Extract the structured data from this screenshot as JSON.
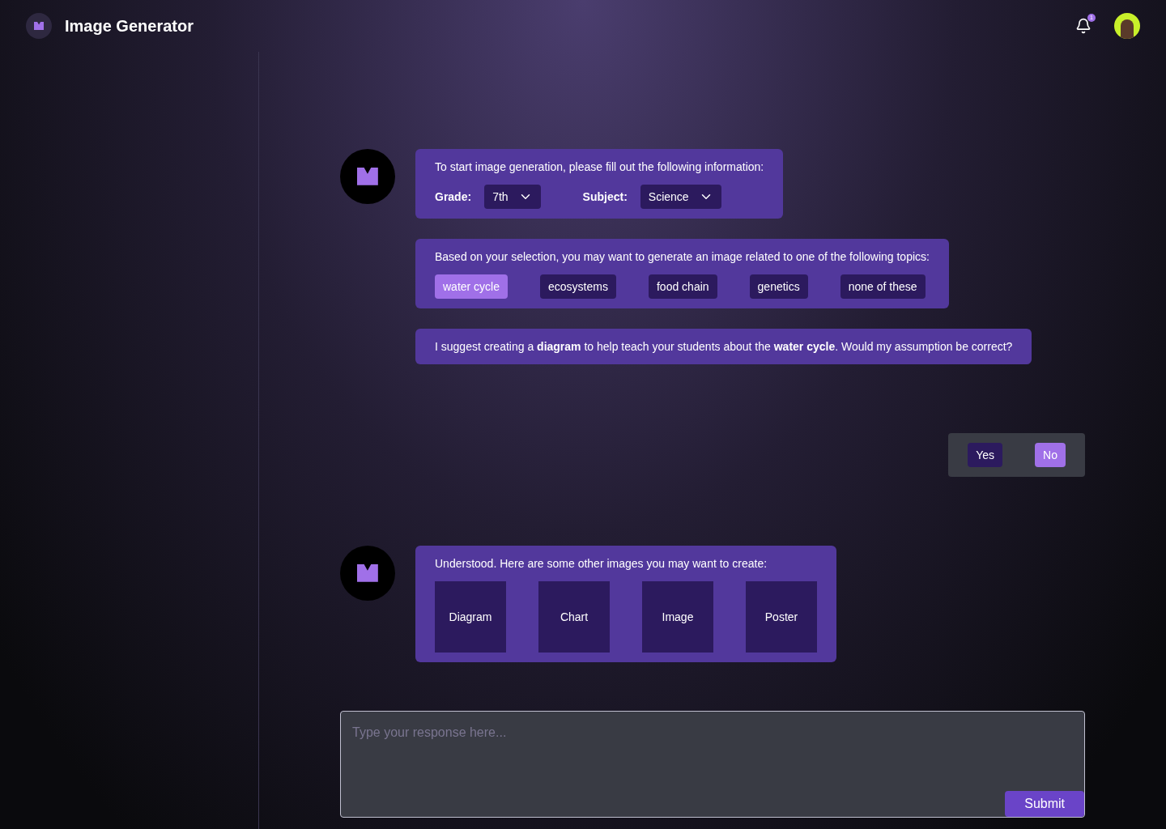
{
  "header": {
    "title": "Image Generator",
    "notification_count": "1"
  },
  "messages": [
    {
      "kind": "form",
      "text": "To start image generation, please fill out the following information:",
      "fields": [
        {
          "label": "Grade:",
          "value": "7th"
        },
        {
          "label": "Subject:",
          "value": "Science"
        }
      ]
    },
    {
      "kind": "topics",
      "text": "Based on your selection, you may want to generate an image related to one of the following topics:",
      "options": [
        {
          "label": "water cycle",
          "selected": true
        },
        {
          "label": "ecosystems",
          "selected": false
        },
        {
          "label": "food chain",
          "selected": false
        },
        {
          "label": "genetics",
          "selected": false
        },
        {
          "label": "none of these",
          "selected": false
        }
      ]
    },
    {
      "kind": "text",
      "text": "I suggest creating a **diagram** to help teach your students about the **water cycle**. Would my assumption be correct?"
    },
    {
      "kind": "reply",
      "options": [
        {
          "label": "Yes",
          "selected": false
        },
        {
          "label": "No",
          "selected": true
        }
      ]
    },
    {
      "kind": "cards",
      "text": "Understood. Here are some other images you may want to create:",
      "options": [
        {
          "label": "Diagram"
        },
        {
          "label": "Chart"
        },
        {
          "label": "Image"
        },
        {
          "label": "Poster"
        }
      ]
    }
  ],
  "composer": {
    "placeholder": "Type your response here...",
    "button": "Submit"
  }
}
